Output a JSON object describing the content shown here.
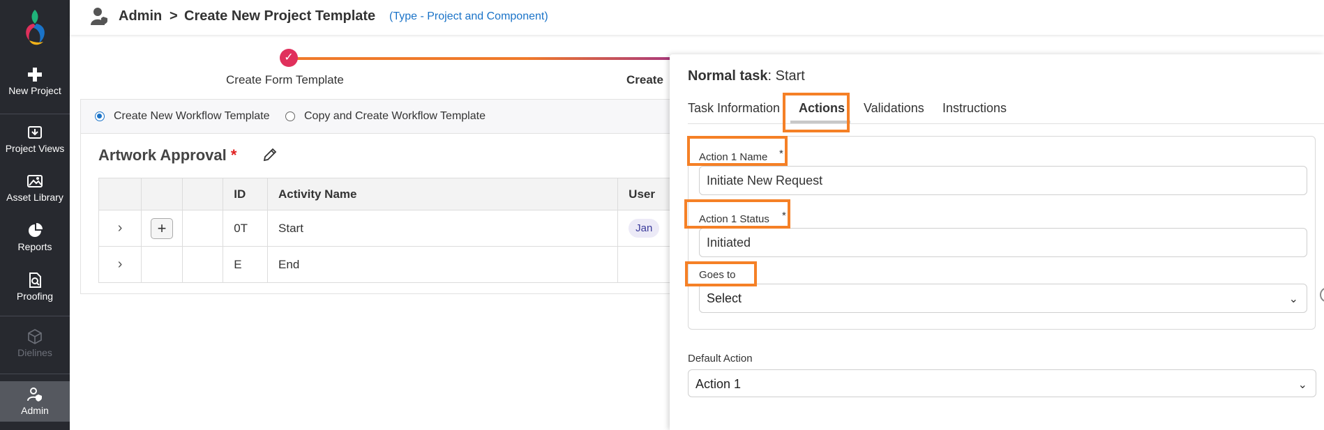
{
  "sidebar": {
    "items": [
      {
        "label": "New Project",
        "icon": "plus-icon"
      },
      {
        "label": "Project Views",
        "icon": "project-views-icon"
      },
      {
        "label": "Asset Library",
        "icon": "image-icon"
      },
      {
        "label": "Reports",
        "icon": "pie-chart-icon"
      },
      {
        "label": "Proofing",
        "icon": "proofing-icon"
      },
      {
        "label": "Dielines",
        "icon": "box-icon"
      },
      {
        "label": "Admin",
        "icon": "admin-user-icon"
      }
    ]
  },
  "header": {
    "crumb_admin": "Admin",
    "separator": ">",
    "crumb_page": "Create New Project Template",
    "type_note": "(Type - Project and Component)"
  },
  "stepper": {
    "step1": "Create Form Template",
    "step2": "Create",
    "step1_check": "✓"
  },
  "workflow": {
    "radio_create": "Create New Workflow Template",
    "radio_copy": "Copy and Create Workflow Template",
    "title": "Artwork Approval",
    "required_mark": "*",
    "columns": [
      "ID",
      "Activity Name",
      "User"
    ],
    "rows": [
      {
        "id": "0T",
        "name": "Start",
        "user": "Jan"
      },
      {
        "id": "E",
        "name": "End",
        "user": ""
      }
    ]
  },
  "panel": {
    "title_bold": "Normal task",
    "title_rest": ": Start",
    "tabs": [
      "Task Information",
      "Actions",
      "Validations",
      "Instructions"
    ],
    "action_name_label": "Action 1 Name",
    "action_name_value": "Initiate New Request",
    "action_status_label": "Action 1 Status",
    "action_status_value": "Initiated",
    "goes_to_label": "Goes to",
    "goes_to_value": "Select",
    "default_action_label": "Default Action",
    "default_action_value": "Action 1",
    "required_mark": "*"
  },
  "colors": {
    "sidebar_bg": "#27292f",
    "accent_blue": "#1a73c8",
    "highlight_orange": "#f58026",
    "step_dot": "#e0305c"
  }
}
